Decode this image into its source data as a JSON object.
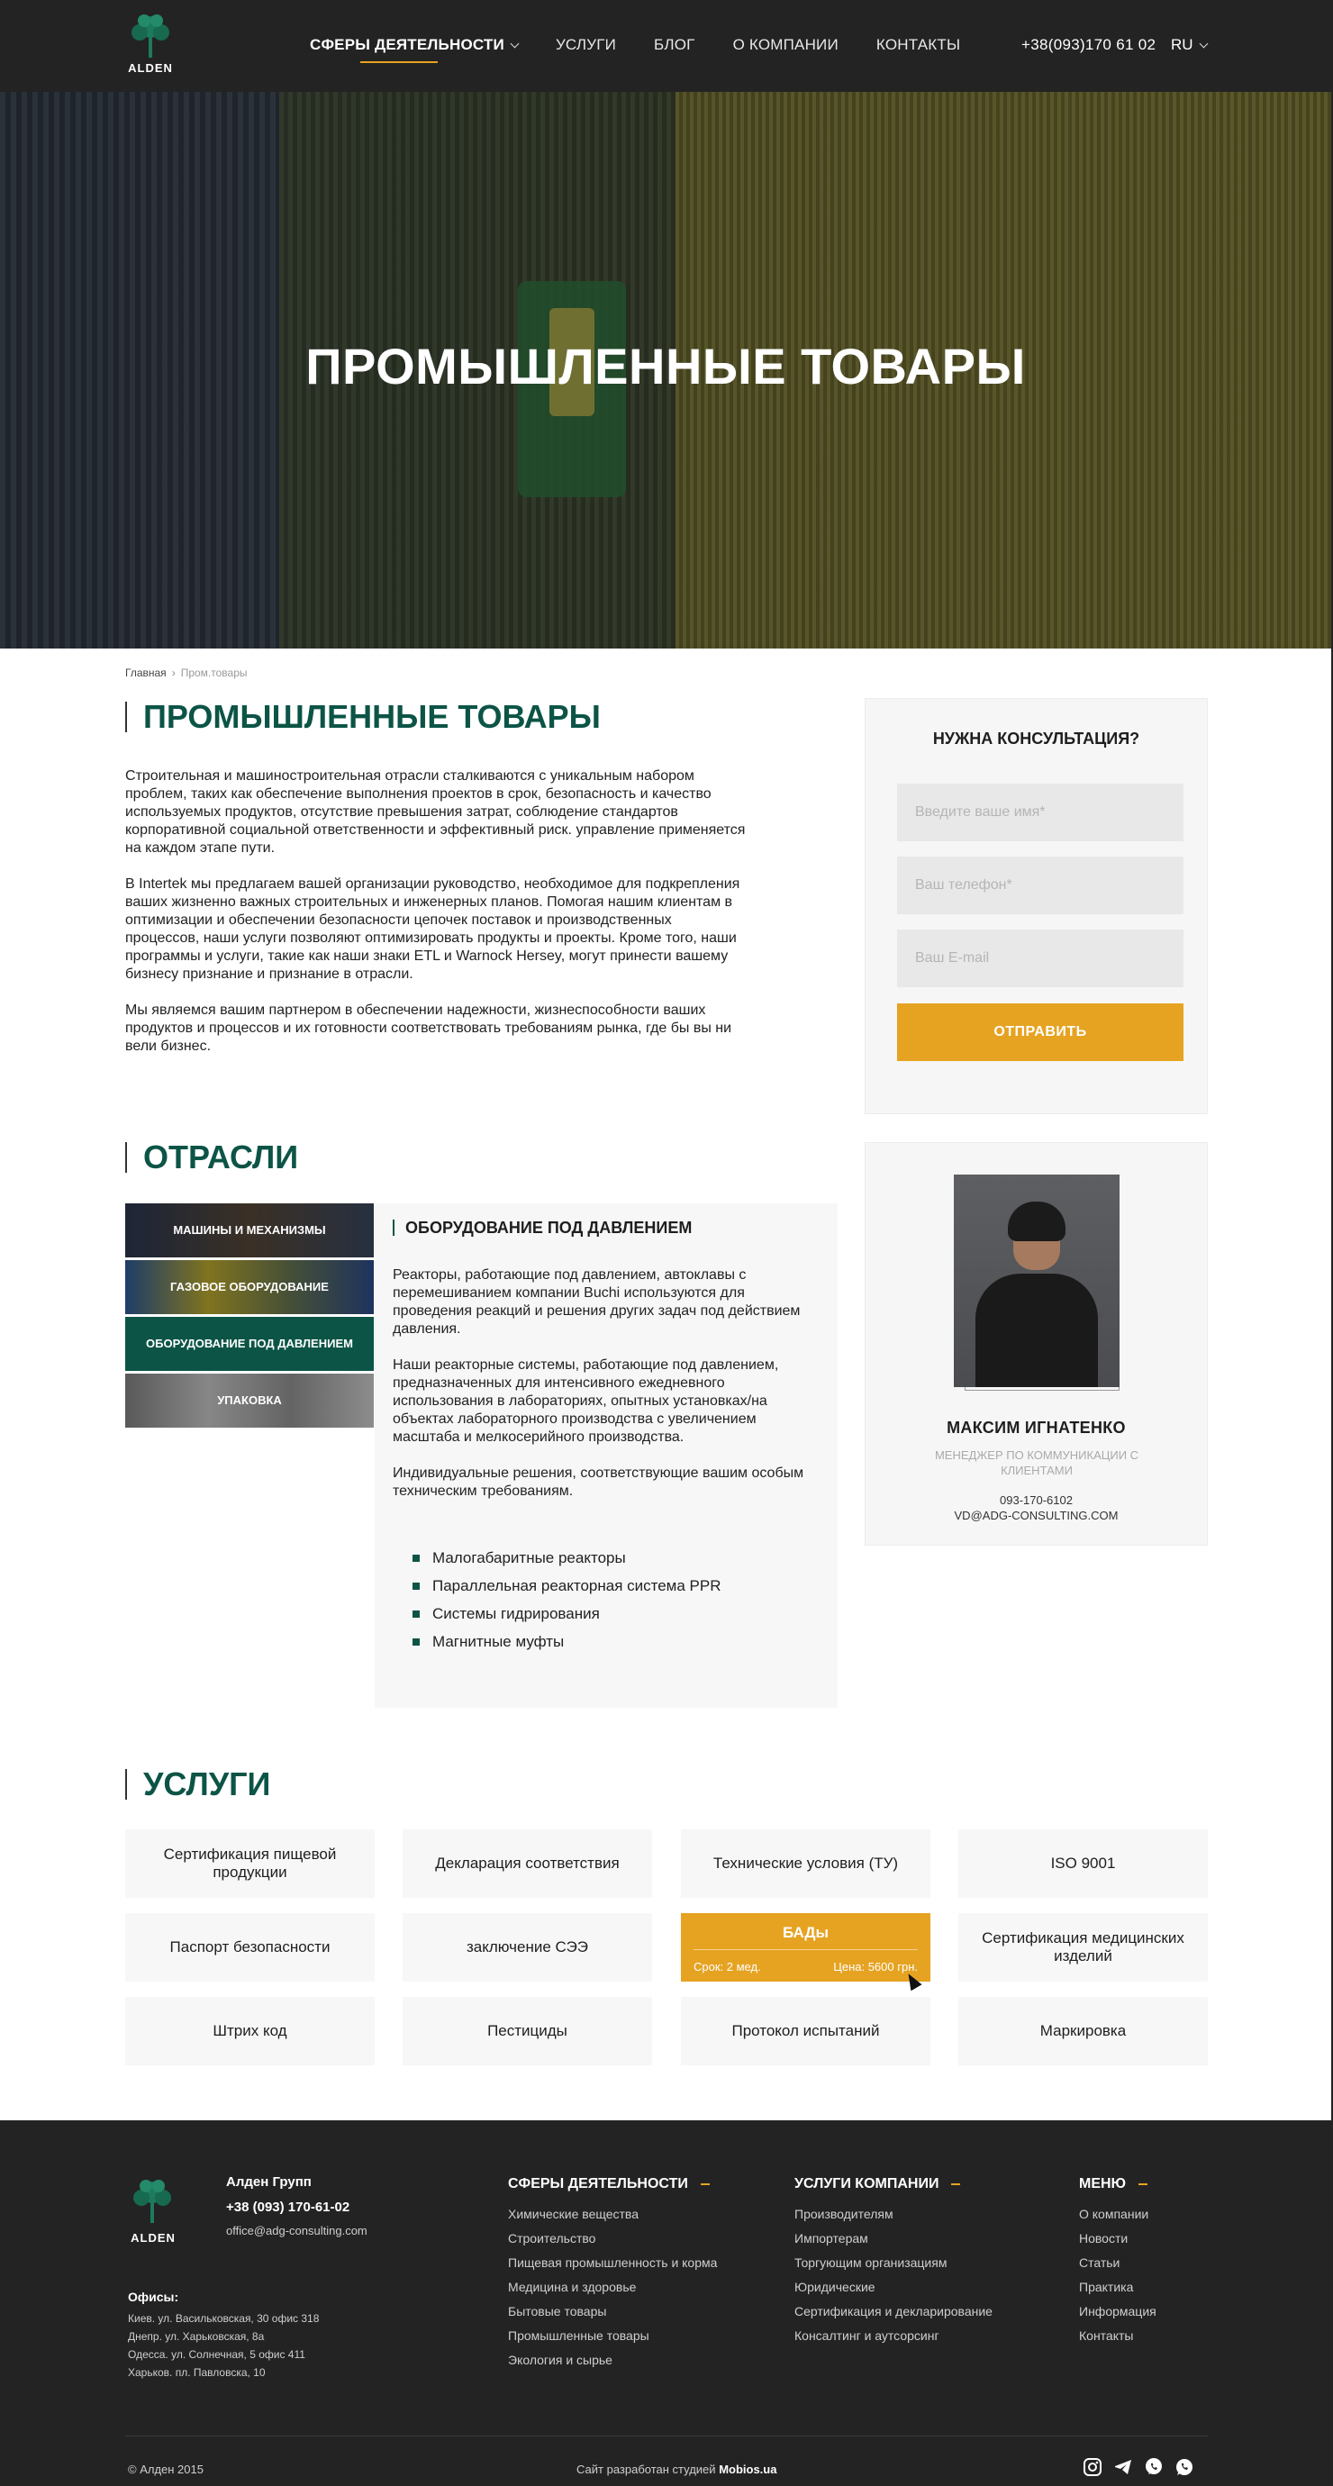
{
  "header": {
    "logo_text": "ALDEN",
    "nav": [
      {
        "label": "СФЕРЫ ДЕЯТЕЛЬНОСТИ"
      },
      {
        "label": "УСЛУГИ"
      },
      {
        "label": "БЛОГ"
      },
      {
        "label": "О КОМПАНИИ"
      },
      {
        "label": "КОНТАКТЫ"
      }
    ],
    "phone": "+38(093)170 61 02",
    "lang": "RU"
  },
  "hero": {
    "title": "ПРОМЫШЛЕННЫЕ ТОВАРЫ"
  },
  "breadcrumb": {
    "home": "Главная",
    "current": "Пром.товары"
  },
  "intro": {
    "title": "ПРОМЫШЛЕННЫЕ ТОВАРЫ",
    "paragraphs": [
      "Строительная и машиностроительная отрасли сталкиваются с уникальным набором проблем, таких как обеспечение выполнения проектов в срок, безопасность и качество используемых продуктов, отсутствие превышения затрат, соблюдение стандартов корпоративной социальной ответственности и эффективный риск. управление применяется на каждом этапе пути.",
      "В Intertek мы предлагаем вашей организации руководство, необходимое для подкрепления ваших жизненно важных строительных и инженерных планов. Помогая нашим клиентам в оптимизации и обеспечении безопасности цепочек поставок и производственных процессов, наши услуги позволяют оптимизировать продукты и проекты. Кроме того, наши программы и услуги, такие как наши знаки ETL и Warnock Hersey, могут принести вашему бизнесу признание и признание в отрасли.",
      "Мы являемся вашим партнером в обеспечении надежности, жизнеспособности ваших продуктов и процессов и их готовности соответствовать требованиям рынка, где бы вы ни вели бизнес."
    ]
  },
  "consult": {
    "title": "НУЖНА КОНСУЛЬТАЦИЯ?",
    "name_placeholder": "Введите ваше имя*",
    "phone_placeholder": "Ваш телефон*",
    "email_placeholder": "Ваш E-mail",
    "submit": "ОТПРАВИТЬ"
  },
  "industries": {
    "title": "ОТРАСЛИ",
    "items": [
      {
        "label": "МАШИНЫ И МЕХАНИЗМЫ"
      },
      {
        "label": "ГАЗОВОЕ ОБОРУДОВАНИЕ"
      },
      {
        "label": "ОБОРУДОВАНИЕ ПОД ДАВЛЕНИЕМ"
      },
      {
        "label": "УПАКОВКА"
      }
    ],
    "active_index": 2,
    "detail": {
      "title": "ОБОРУДОВАНИЕ ПОД ДАВЛЕНИЕМ",
      "paragraphs": [
        "Реакторы, работающие под давлением, автоклавы с перемешиванием компании Buchi используются для проведения реакций и решения других задач под действием давления.",
        "Наши реакторные системы, работающие под давлением, предназначенных для интенсивного ежедневного использования в лабораториях, опытных установках/на объектах лабораторного производства с увеличением масштаба и мелкосерийного производства.",
        "Индивидуальные решения, соответствующие вашим особым техническим требованиям."
      ],
      "list": [
        "Малогабаритные реакторы",
        "Параллельная реакторная система PPR",
        "Системы гидрирования",
        "Магнитные муфты"
      ]
    }
  },
  "manager": {
    "name": "МАКСИМ ИГНАТЕНКО",
    "role": "МЕНЕДЖЕР ПО КОММУНИКАЦИИ С КЛИЕНТАМИ",
    "phone": "093-170-6102",
    "email": "VD@ADG-CONSULTING.COM"
  },
  "services": {
    "title": "УСЛУГИ",
    "items": [
      {
        "label": "Сертификация пищевой продукции"
      },
      {
        "label": "Декларация соответствия"
      },
      {
        "label": "Технические условия (ТУ)"
      },
      {
        "label": "ISO 9001"
      },
      {
        "label": "Паспорт безопасности"
      },
      {
        "label": "заключение СЭЭ"
      },
      {
        "label": "БАДы",
        "term": "Срок: 2 мед.",
        "price": "Цена: 5600 грн."
      },
      {
        "label": "Сертификация медицинских изделий"
      },
      {
        "label": "Штрих код"
      },
      {
        "label": "Пестициды"
      },
      {
        "label": "Протокол испытаний"
      },
      {
        "label": "Маркировка"
      }
    ]
  },
  "footer": {
    "logo_text": "ALDEN",
    "company": "Алден Групп",
    "phone": "+38 (093) 170-61-02",
    "email": "office@adg-consulting.com",
    "offices_title": "Офисы:",
    "offices": [
      "Киев. ул. Васильковская, 30 офис 318",
      "Днепр. ул. Харьковская, 8а",
      "Одесса. ул. Солнечная, 5 офис 411",
      "Харьков. пл. Павловска, 10"
    ],
    "col1": {
      "title": "СФЕРЫ ДЕЯТЕЛЬНОСТИ",
      "links": [
        "Химические вещества",
        "Строительство",
        "Пищевая промышленность и корма",
        "Медицина и здоровье",
        "Бытовые товары",
        "Промышленные товары",
        "Экология и сырье"
      ]
    },
    "col2": {
      "title": "УСЛУГИ КОМПАНИИ",
      "links": [
        "Производителям",
        "Импортерам",
        "Торгующим организациям",
        "Юридические",
        "Сертификация и декларирование",
        "Консалтинг и аутсорсинг"
      ]
    },
    "col3": {
      "title": "МЕНЮ",
      "links": [
        "О компании",
        "Новости",
        "Статьи",
        "Практика",
        "Информация",
        "Контакты"
      ]
    },
    "copyright": "© Алден 2015",
    "studio_prefix": "Сайт разработан студией",
    "studio_name": "Mobios.ua",
    "socials": [
      "instagram-icon",
      "telegram-icon",
      "viber-icon",
      "whatsapp-icon"
    ]
  },
  "colors": {
    "accent": "#e6a322",
    "brand": "#0c5446",
    "dark": "#232323"
  }
}
